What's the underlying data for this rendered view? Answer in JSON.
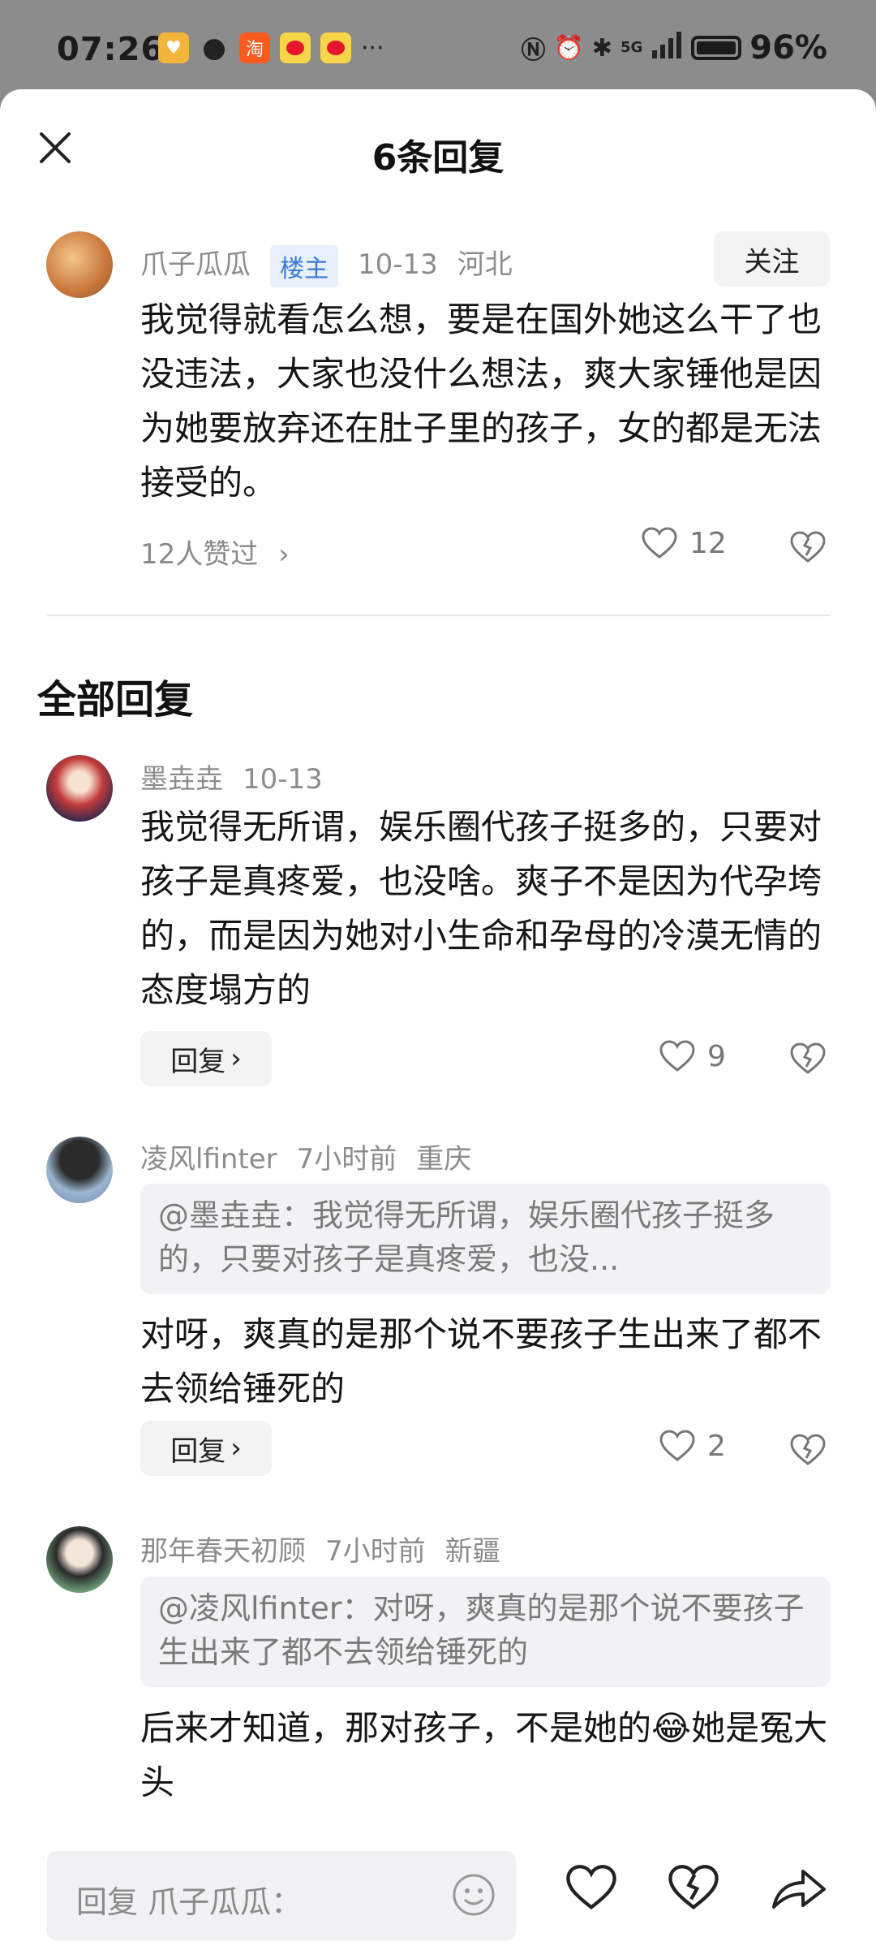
{
  "status_bar": {
    "time": "07:26",
    "battery": "96%",
    "more": "···",
    "network": "5G",
    "icons": [
      "wallet-app-icon",
      "wechat-icon",
      "taobao-icon",
      "weibo-icon",
      "weibo-icon",
      "nfc-icon",
      "alarm-icon",
      "bluetooth-icon",
      "signal-icon",
      "battery-icon"
    ],
    "taobao_glyph": "淘"
  },
  "header": {
    "title": "6条回复"
  },
  "main_comment": {
    "author": "爪子瓜瓜",
    "badge": "楼主",
    "date": "10-13",
    "location": "河北",
    "follow_label": "关注",
    "text": "我觉得就看怎么想，要是在国外她这么干了也没违法，大家也没什么想法，爽大家锤他是因为她要放弃还在肚子里的孩子，女的都是无法接受的。",
    "liked_by": "12人赞过",
    "like_count": "12"
  },
  "section_title": "全部回复",
  "replies": [
    {
      "author": "墨垚垚",
      "date": "10-13",
      "location": "",
      "text": "我觉得无所谓，娱乐圈代孩子挺多的，只要对孩子是真疼爱，也没啥。爽子不是因为代孕垮的，而是因为她对小生命和孕母的冷漠无情的态度塌方的",
      "reply_label": "回复",
      "like_count": "9"
    },
    {
      "author": "凌风lfinter",
      "date": "7小时前",
      "location": "重庆",
      "quote": "@墨垚垚：我觉得无所谓，娱乐圈代孩子挺多的，只要对孩子是真疼爱，也没...",
      "text": "对呀，爽真的是那个说不要孩子生出来了都不去领给锤死的",
      "reply_label": "回复",
      "like_count": "2"
    },
    {
      "author": "那年春天初顾",
      "date": "7小时前",
      "location": "新疆",
      "quote": "@凌风lfinter：对呀，爽真的是那个说不要孩子生出来了都不去领给锤死的",
      "text_before": "后来才知道，那对孩子，不是她的",
      "emoji": "😂",
      "text_after": "她是冤大头"
    }
  ],
  "bottom_bar": {
    "placeholder": "回复 爪子瓜瓜："
  },
  "colors": {
    "badge_bg": "#e7f0fb",
    "badge_text": "#3b7bd6",
    "meta_text": "#8c8c8c",
    "button_bg": "#f3f3f3"
  }
}
